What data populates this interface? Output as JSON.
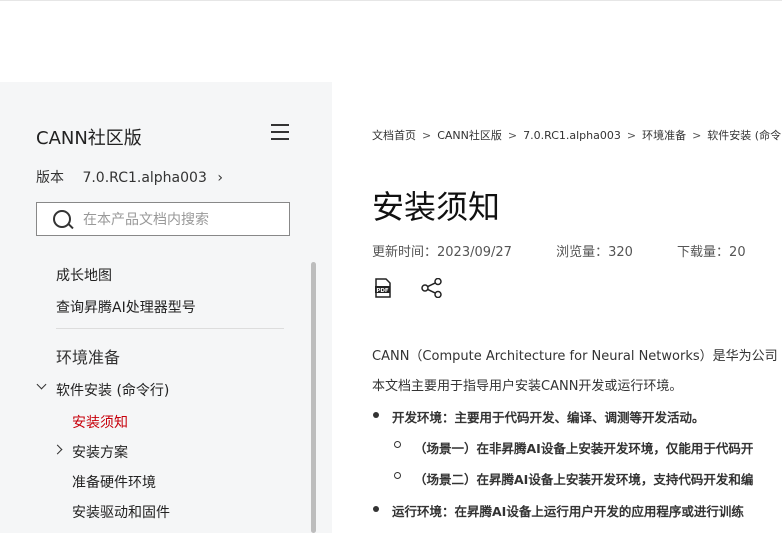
{
  "sidebar": {
    "product_title": "CANN社区版",
    "version_label": "版本",
    "version_value": "7.0.RC1.alpha003",
    "search_placeholder": "在本产品文档内搜索",
    "links": [
      "成长地图",
      "查询昇腾AI处理器型号"
    ],
    "section": "环境准备",
    "tree": {
      "parent": "软件安装 (命令行)",
      "children": [
        "安装须知",
        "安装方案",
        "准备硬件环境",
        "安装驱动和固件"
      ]
    }
  },
  "main": {
    "breadcrumb": [
      "文档首页",
      "CANN社区版",
      "7.0.RC1.alpha003",
      "环境准备",
      "软件安装 (命令"
    ],
    "breadcrumb_sep": ">",
    "title": "安装须知",
    "meta": {
      "updated": "更新时间：2023/09/27",
      "views": "浏览量：320",
      "downloads": "下载量：20"
    },
    "para1": "CANN（Compute Architecture for Neural Networks）是华为公司",
    "para2": "本文档主要用于指导用户安装CANN开发或运行环境。",
    "bullets": [
      "开发环境：主要用于代码开发、编译、调测等开发活动。",
      "（场景一）在非昇腾AI设备上安装开发环境，仅能用于代码开",
      "（场景二）在昇腾AI设备上安装开发环境，支持代码开发和编",
      "运行环境：在昇腾AI设备上运行用户开发的应用程序或进行训练"
    ]
  },
  "icons": {
    "menu": "menu-icon",
    "search": "search-icon",
    "pdf": "pdf-icon",
    "share": "share-icon"
  },
  "colors": {
    "active": "#c7000b",
    "sidebar_bg": "#f5f6f7"
  }
}
